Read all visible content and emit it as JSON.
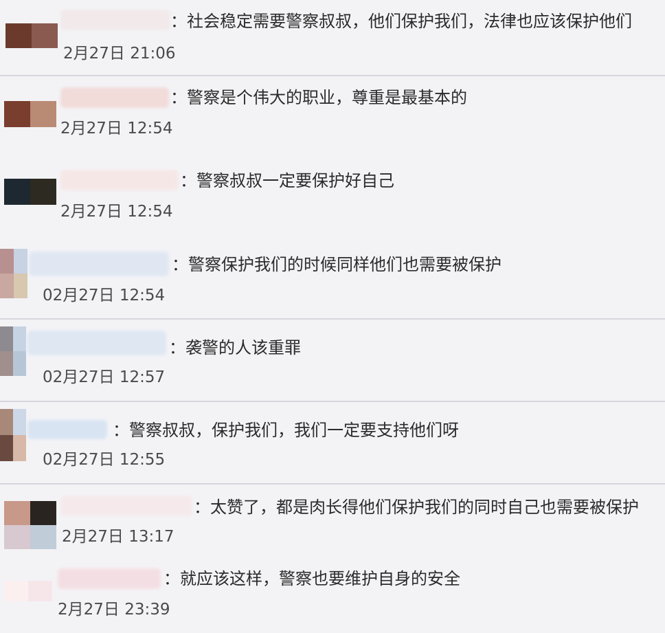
{
  "comments": [
    {
      "text": "：社会稳定需要警察叔叔，他们保护我们，法律也应该保护他们",
      "time": "2月27日 21:06",
      "avatar_colors": [
        "#6b3a2c",
        "#8a5a50",
        "#f3f3f6",
        "#f3f3f6"
      ],
      "name_color": "#f1e8e8"
    },
    {
      "text": "：警察是个伟大的职业，尊重是最基本的",
      "time": "2月27日 12:54",
      "avatar_colors": [
        "#7a3e2e",
        "#b98a74",
        "#f3f3f6",
        "#f3f3f6"
      ],
      "name_color": "#f2d8d6"
    },
    {
      "text": "：警察叔叔一定要保护好自己",
      "time": "2月27日 12:54",
      "avatar_colors": [
        "#1e2830",
        "#2d2a22",
        "#f3f3f6",
        "#f3f3f6"
      ],
      "name_color": "#f6e6e4"
    },
    {
      "text": "：警察保护我们的时候同样他们也需要被保护",
      "time": "02月27日 12:54",
      "avatar_colors": [
        "#b89090",
        "#c7d2e3",
        "#c8a8a0",
        "#d8c8b0"
      ],
      "name_color": "#dde6f2"
    },
    {
      "text": "：袭警的人该重罪",
      "time": "02月27日 12:57",
      "avatar_colors": [
        "#8d8a90",
        "#c5d3e3",
        "#a08f8c",
        "#b7c6d6"
      ],
      "name_color": "#dbe6f2"
    },
    {
      "text": "：警察叔叔，保护我们，我们一定要支持他们呀",
      "time": "02月27日 12:55",
      "avatar_colors": [
        "#a88878",
        "#ccd8e8",
        "#6a4a40",
        "#d8b8a8"
      ],
      "name_color": "#d5e2f2"
    },
    {
      "text": "：太赞了，都是肉长得他们保护我们的同时自己也需要被保护",
      "time": "2月27日 13:17",
      "avatar_colors": [
        "#c89888",
        "#2a2420",
        "#d8c8d0",
        "#c0ccd8"
      ],
      "name_color": "#f6e8ea"
    },
    {
      "text": "：就应该这样，警察也要维护自身的安全",
      "time": "2月27日 23:39",
      "avatar_colors": [
        "#fbeff0",
        "#f6e6ea",
        "#f3f3f6",
        "#f3f3f6"
      ],
      "name_color": "#f4dce0"
    }
  ]
}
